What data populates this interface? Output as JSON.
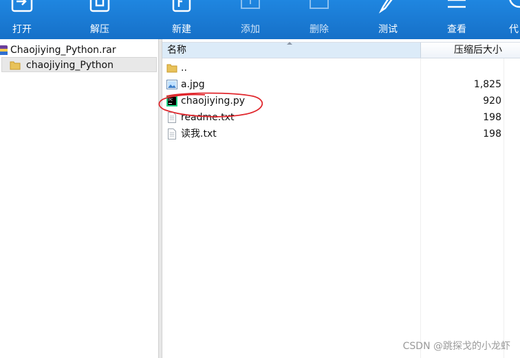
{
  "toolbar": {
    "items": [
      {
        "label": "打开",
        "icon": "open-archive-icon"
      },
      {
        "label": "解压",
        "icon": "extract-icon"
      },
      {
        "label": "新建",
        "icon": "new-archive-icon"
      },
      {
        "label": "添加",
        "icon": "add-icon"
      },
      {
        "label": "删除",
        "icon": "delete-icon"
      },
      {
        "label": "测试",
        "icon": "test-icon"
      },
      {
        "label": "查看",
        "icon": "view-icon"
      },
      {
        "label": "代",
        "icon": "more-icon"
      }
    ]
  },
  "tree": {
    "archive": "Chaojiying_Python.rar",
    "folder": "chaojiying_Python"
  },
  "list": {
    "columns": {
      "name": "名称",
      "size": "压缩后大小"
    },
    "rows": [
      {
        "name": "..",
        "size": "",
        "icon": "folder-icon"
      },
      {
        "name": "a.jpg",
        "size": "1,825",
        "icon": "image-file-icon"
      },
      {
        "name": "chaojiying.py",
        "size": "920",
        "icon": "pycharm-file-icon"
      },
      {
        "name": "readme.txt",
        "size": "198",
        "icon": "text-file-icon"
      },
      {
        "name": "读我.txt",
        "size": "198",
        "icon": "text-file-icon"
      }
    ]
  },
  "watermark": "CSDN @跳探戈的小龙虾",
  "colors": {
    "toolbar": "#1a7bd6",
    "annotation": "#e0262c",
    "header_selected": "#dcebf8"
  }
}
